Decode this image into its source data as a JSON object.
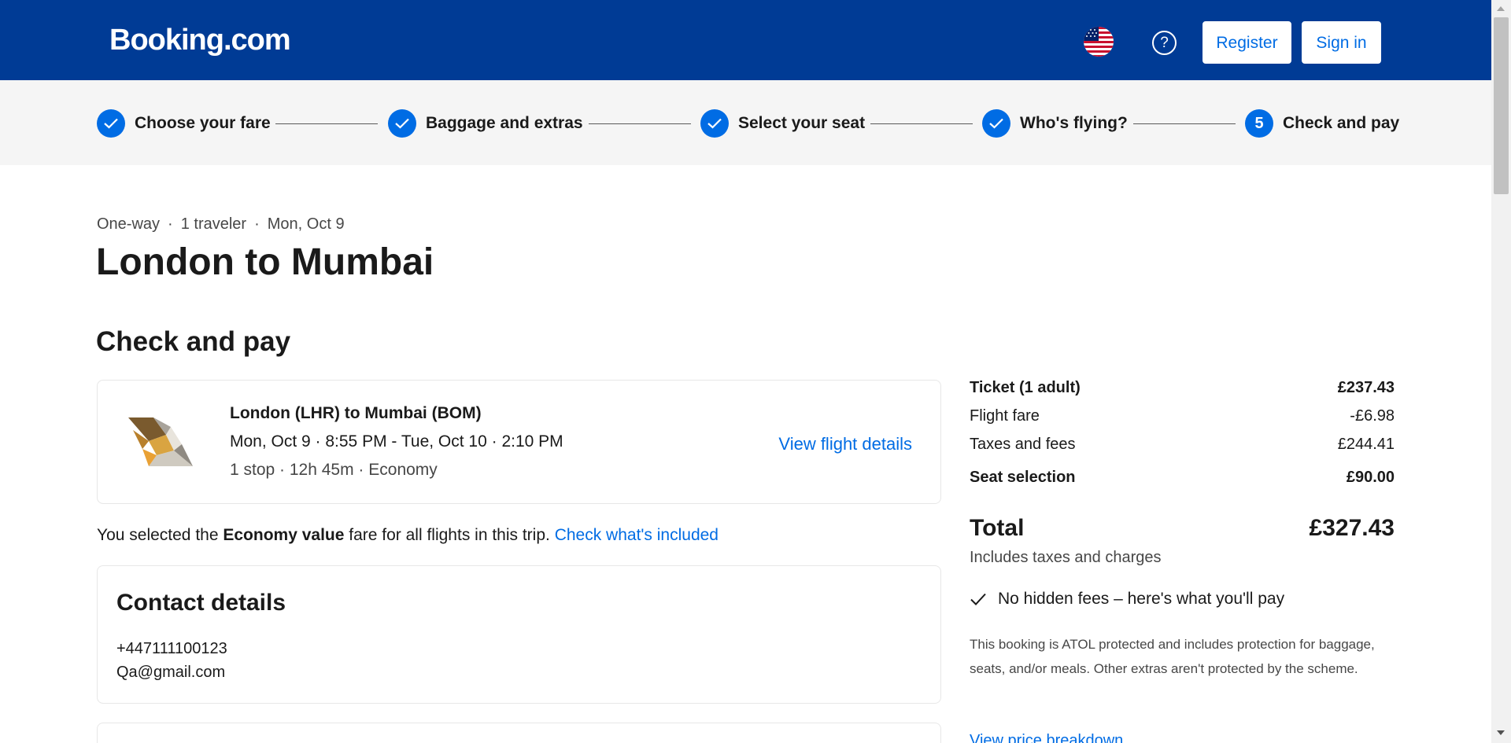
{
  "header": {
    "logo": "Booking.com",
    "flag_icon": "us-flag-icon",
    "help_icon": "help-icon",
    "help_glyph": "?",
    "register_label": "Register",
    "signin_label": "Sign in"
  },
  "progress": {
    "steps": [
      {
        "label": "Choose your fare",
        "status": "done"
      },
      {
        "label": "Baggage and extras",
        "status": "done"
      },
      {
        "label": "Select your seat",
        "status": "done"
      },
      {
        "label": "Who's flying?",
        "status": "done"
      },
      {
        "label": "Check and pay",
        "status": "current",
        "number": "5"
      }
    ]
  },
  "trip": {
    "type": "One-way",
    "travelers": "1 traveler",
    "date": "Mon, Oct 9",
    "separator": "·",
    "title": "London to Mumbai"
  },
  "section_title": "Check and pay",
  "flight": {
    "route": "London (LHR) to Mumbai (BOM)",
    "times": "Mon, Oct 9 · 8:55 PM - Tue, Oct 10 · 2:10 PM",
    "details": "1 stop · 12h 45m · Economy",
    "link_label": "View flight details"
  },
  "fare_note": {
    "prefix": "You selected the ",
    "fare_name": "Economy value",
    "suffix": " fare for all flights in this trip. ",
    "link_label": "Check what's included"
  },
  "contact": {
    "title": "Contact details",
    "phone": "+447111100123",
    "email": "Qa@gmail.com"
  },
  "price": {
    "rows": [
      {
        "label": "Ticket (1 adult)",
        "value": "£237.43",
        "bold": true
      },
      {
        "label": "Flight fare",
        "value": "-£6.98",
        "bold": false
      },
      {
        "label": "Taxes and fees",
        "value": "£244.41",
        "bold": false
      },
      {
        "label": "Seat selection",
        "value": "£90.00",
        "bold": true
      }
    ],
    "total_label": "Total",
    "total_value": "£327.43",
    "includes": "Includes taxes and charges",
    "no_hidden": "No hidden fees – here's what you'll pay",
    "atol": "This booking is ATOL protected and includes protection for baggage, seats, and/or meals. Other extras aren't protected by the scheme.",
    "breakdown_link": "View price breakdown"
  },
  "colors": {
    "brand_blue": "#003b95",
    "action_blue": "#006ce4"
  }
}
